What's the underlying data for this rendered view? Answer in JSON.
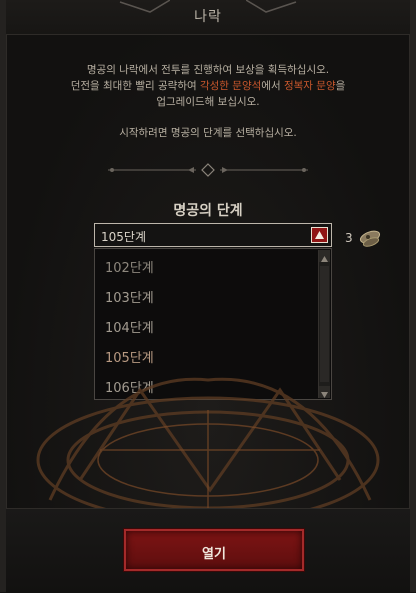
{
  "header": {
    "title": "나락"
  },
  "info": {
    "line1": "명공의 나락에서 전투를 진행하여 보상을 획득하십시오.",
    "line2_a": "던전을 최대한 빨리 공략하여 ",
    "line2_hl1": "각성한 문양석",
    "line2_b": "에서 ",
    "line2_hl2": "정복자 문양",
    "line2_c": "을",
    "line3": "업그레이드해 보십시오.",
    "instruction": "시작하려면 명공의 단계를 선택하십시오."
  },
  "selector": {
    "title": "명공의 단계",
    "selected": "105단계",
    "cost": "3",
    "cost_icon": "key-sigil-icon",
    "options": [
      "102단계",
      "103단계",
      "104단계",
      "105단계",
      "106단계"
    ]
  },
  "footer": {
    "open_label": "열기"
  },
  "colors": {
    "accent": "#c9572c",
    "button": "#7d1414"
  }
}
